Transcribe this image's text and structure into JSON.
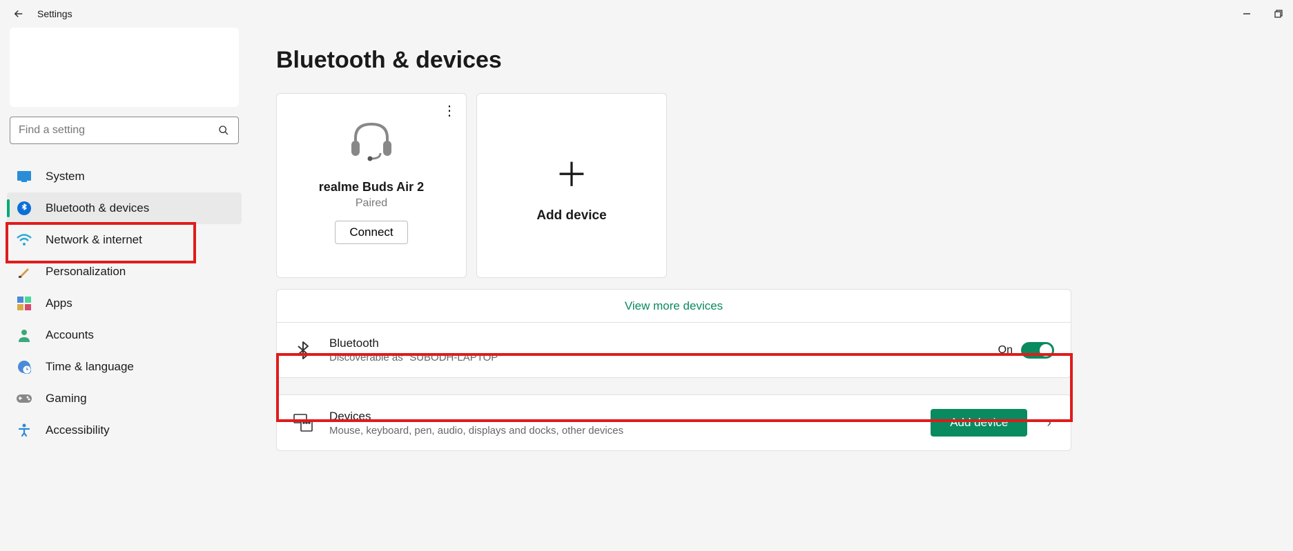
{
  "window": {
    "title": "Settings"
  },
  "search": {
    "placeholder": "Find a setting"
  },
  "nav": {
    "system": "System",
    "bluetooth": "Bluetooth & devices",
    "network": "Network & internet",
    "personalization": "Personalization",
    "apps": "Apps",
    "accounts": "Accounts",
    "time": "Time & language",
    "gaming": "Gaming",
    "accessibility": "Accessibility"
  },
  "page": {
    "title": "Bluetooth & devices",
    "view_more": "View more devices"
  },
  "device_card": {
    "name": "realme Buds Air 2",
    "status": "Paired",
    "connect": "Connect"
  },
  "add_card": {
    "label": "Add device"
  },
  "bluetooth_row": {
    "title": "Bluetooth",
    "subtitle": "Discoverable as \"SUBODH-LAPTOP\"",
    "state": "On"
  },
  "devices_row": {
    "title": "Devices",
    "subtitle": "Mouse, keyboard, pen, audio, displays and docks, other devices",
    "button": "Add device"
  }
}
